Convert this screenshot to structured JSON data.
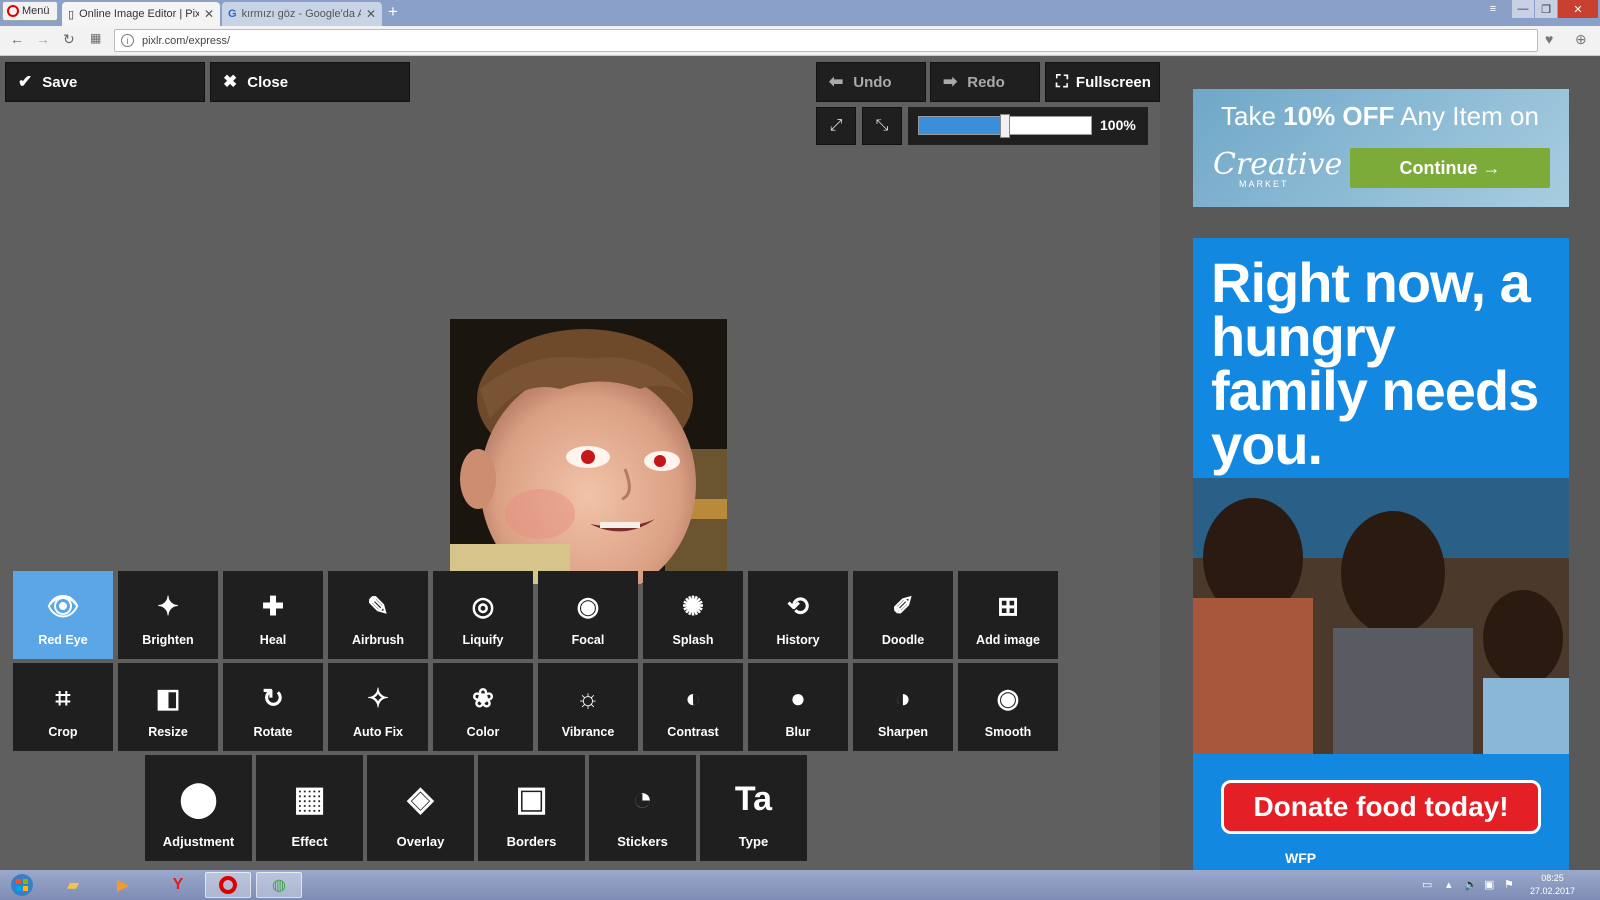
{
  "browser": {
    "menu_label": "Menü",
    "tabs": [
      {
        "label": "Online Image Editor | Pixlr",
        "close": "✕"
      },
      {
        "label": "kırmızı göz - Google'da Ar",
        "close": "✕"
      }
    ],
    "new_tab": "+",
    "url": "pixlr.com/express/"
  },
  "toolbar": {
    "save_label": "Save",
    "close_label": "Close",
    "undo_label": "Undo",
    "redo_label": "Redo",
    "fullscreen_label": "Fullscreen"
  },
  "zoom": {
    "value_label": "100%",
    "slider_fraction": 0.5
  },
  "tools": {
    "row1": [
      "Red Eye",
      "Brighten",
      "Heal",
      "Airbrush",
      "Liquify",
      "Focal",
      "Splash",
      "History",
      "Doodle",
      "Add image"
    ],
    "row2": [
      "Crop",
      "Resize",
      "Rotate",
      "Auto Fix",
      "Color",
      "Vibrance",
      "Contrast",
      "Blur",
      "Sharpen",
      "Smooth"
    ],
    "row3": [
      "Adjustment",
      "Effect",
      "Overlay",
      "Borders",
      "Stickers",
      "Type"
    ],
    "selected": "Red Eye"
  },
  "ad_top": {
    "headline_pre": "Take ",
    "headline_bold": "10% OFF",
    "headline_post": " Any Item on",
    "brand": "Creative",
    "brand_sub": "MARKET",
    "cta": "Continue →"
  },
  "ad_bottom": {
    "headline": "Right now, a hungry family needs you.",
    "cta": "Donate food today!",
    "org": "WFP"
  },
  "taskbar": {
    "time": "08:25",
    "date": "27.02.2017"
  }
}
